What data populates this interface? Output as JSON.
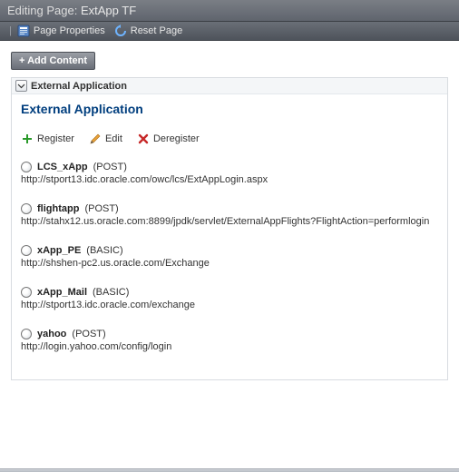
{
  "header": {
    "prefix": "Editing Page:",
    "title": "ExtApp TF"
  },
  "toolbar": {
    "page_properties": "Page Properties",
    "reset_page": "Reset Page"
  },
  "add_content_label": "+ Add Content",
  "panel": {
    "header": "External Application",
    "title": "External Application"
  },
  "actions": {
    "register": "Register",
    "edit": "Edit",
    "deregister": "Deregister"
  },
  "apps": [
    {
      "name": "LCS_xApp",
      "method": "(POST)",
      "url": "http://stport13.idc.oracle.com/owc/lcs/ExtAppLogin.aspx"
    },
    {
      "name": "flightapp",
      "method": "(POST)",
      "url": "http://stahx12.us.oracle.com:8899/jpdk/servlet/ExternalAppFlights?FlightAction=performlogin"
    },
    {
      "name": "xApp_PE",
      "method": "(BASIC)",
      "url": "http://shshen-pc2.us.oracle.com/Exchange"
    },
    {
      "name": "xApp_Mail",
      "method": "(BASIC)",
      "url": "http://stport13.idc.oracle.com/exchange"
    },
    {
      "name": "yahoo",
      "method": "(POST)",
      "url": "http://login.yahoo.com/config/login"
    }
  ]
}
